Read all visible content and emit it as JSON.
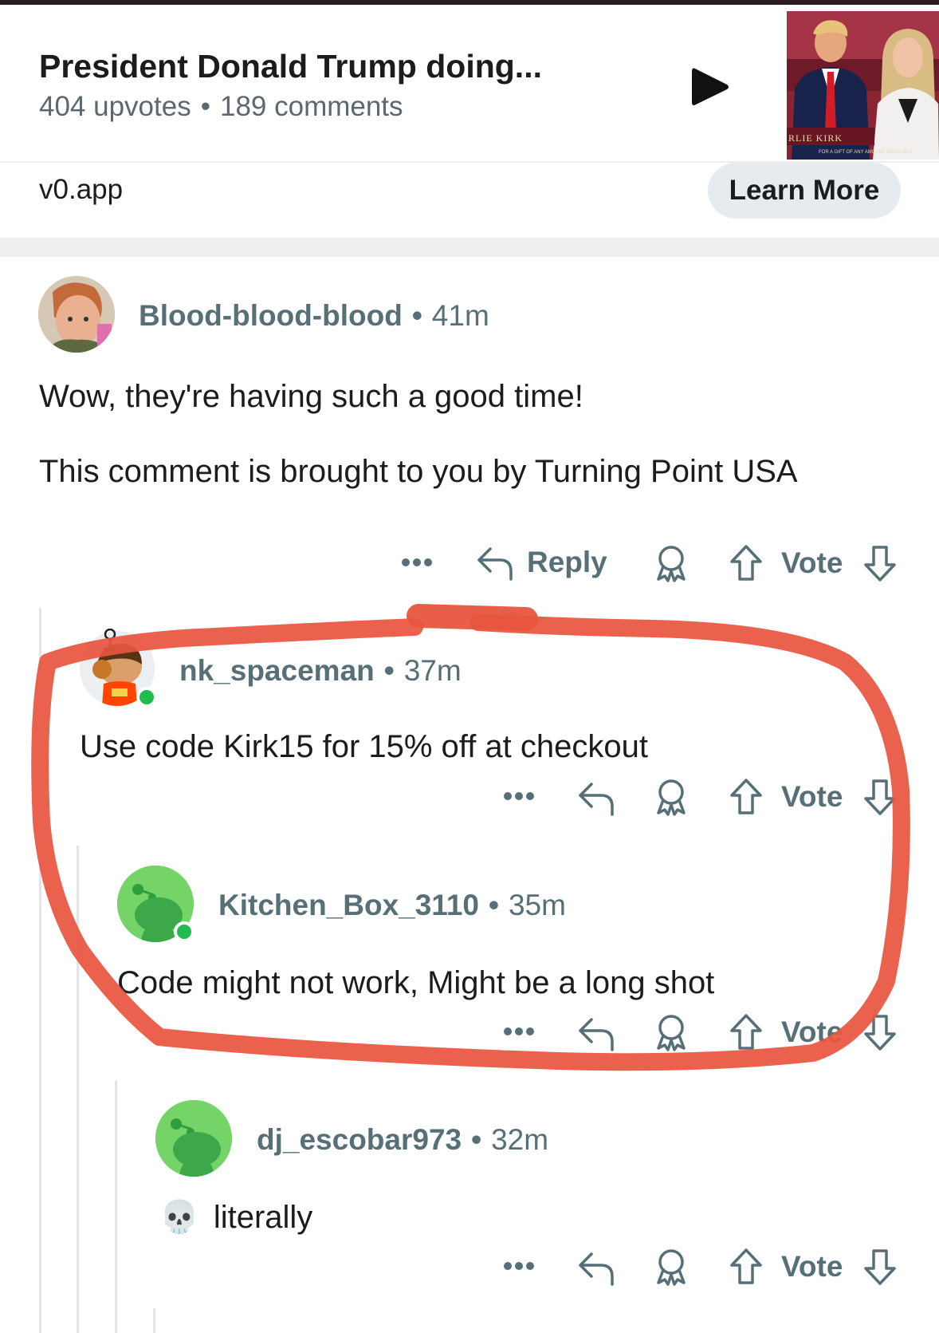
{
  "promo": {
    "title": "President Donald Trump doing...",
    "upvotes": "404 upvotes",
    "separator": "•",
    "comments": "189 comments",
    "domain": "v0.app",
    "cta": "Learn More",
    "thumbnail_caption": "RLIE KIRK",
    "thumbnail_subcaption": "FOR A GIFT OF ANY AMOUNT RECEIVE A"
  },
  "comments": [
    {
      "username": "Blood-blood-blood",
      "time": "41m",
      "body": [
        "Wow, they're having such a good time!",
        "This comment is brought to you by Turning Point USA"
      ],
      "reply_label": "Reply",
      "vote_label": "Vote"
    },
    {
      "username": "nk_spaceman",
      "time": "37m",
      "body": "Use code Kirk15 for 15% off at checkout",
      "vote_label": "Vote"
    },
    {
      "username": "Kitchen_Box_3110",
      "time": "35m",
      "body": "Code might not work, Might be a long shot",
      "vote_label": "Vote"
    },
    {
      "username": "dj_escobar973",
      "time": "32m",
      "body": "literally",
      "emoji": "💀",
      "vote_label": "Vote"
    }
  ],
  "meta_separator": "•",
  "colors": {
    "annotation": "#e8553e",
    "meta_text": "#576f76",
    "online": "#1fbd4e",
    "snoo_green": "#46d160"
  },
  "icons": [
    "play-icon",
    "more-icon",
    "reply-icon",
    "award-icon",
    "upvote-icon",
    "downvote-icon"
  ]
}
